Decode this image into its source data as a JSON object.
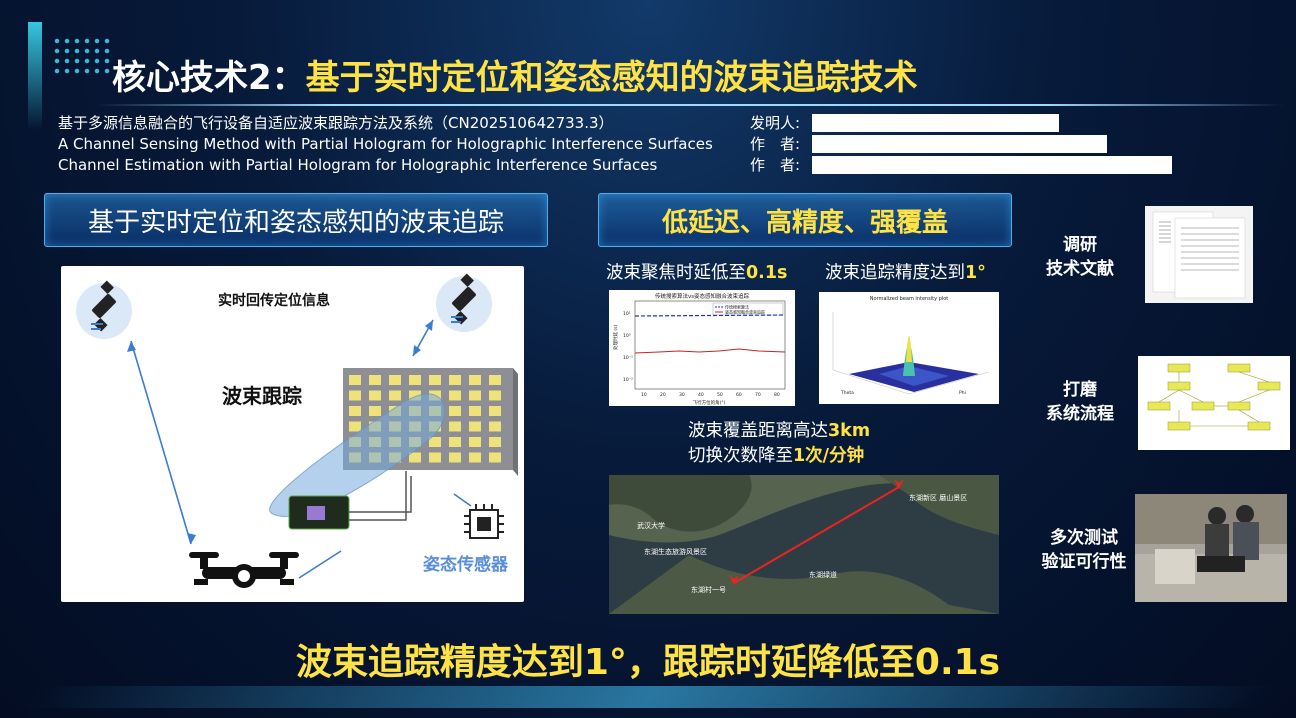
{
  "title": {
    "prefix": "核心技术2：",
    "main": "基于实时定位和姿态感知的波束追踪技术"
  },
  "info": {
    "lines": [
      "基于多源信息融合的飞行设备自适应波束跟踪方法及系统（CN202510642733.3）",
      "A Channel Sensing Method with Partial Hologram for Holographic Interference Surfaces",
      "Channel Estimation with Partial Hologram for Holographic Interference Surfaces"
    ],
    "labels": [
      "发明人:",
      "作　者:",
      "作　者:"
    ]
  },
  "left_panel": {
    "header": "基于实时定位和姿态感知的波束追踪",
    "realtime_label": "实时回传定位信息",
    "beam_label": "波束跟踪",
    "sensor_label": "姿态传感器"
  },
  "right_panel": {
    "header": "低延迟、高精度、强覆盖",
    "caption_delay": {
      "text": "波束聚焦时延低至",
      "value": "0.1s"
    },
    "caption_accuracy": {
      "text": "波束追踪精度达到",
      "value": "1°"
    },
    "caption_distance": {
      "text": "波束覆盖距离高达",
      "value": "3km"
    },
    "caption_switch": {
      "text": "切换次数降至",
      "value": "1次/分钟"
    },
    "chart1": {
      "title": "传统搜索算法vs姿态感知融合波束追踪",
      "legend": [
        "传统搜索算法",
        "姿态感知融合波束追踪"
      ],
      "ylabel": "处理时延 (s)",
      "xlabel": "飞行方位的角(°)",
      "xticks": [
        "10",
        "20",
        "30",
        "40",
        "50",
        "60",
        "70",
        "80"
      ],
      "yticks": [
        "10¹",
        "10⁰",
        "10⁻¹",
        "10⁻²"
      ]
    },
    "chart2": {
      "title": "Normalized beam intensity plot",
      "xlabel": "Theta",
      "ylabel": "Phi"
    },
    "map_labels": [
      "东湖生态旅游风景区",
      "东湖绿道",
      "武汉大学",
      "东湖村一号",
      "东湖新区 磨山景区"
    ]
  },
  "side": {
    "items": [
      {
        "label_line1": "调研",
        "label_line2": "技术文献"
      },
      {
        "label_line1": "打磨",
        "label_line2": "系统流程"
      },
      {
        "label_line1": "多次测试",
        "label_line2": "验证可行性"
      }
    ]
  },
  "bottom": {
    "text": "波束追踪精度达到1°，跟踪时延降低至0.1s"
  },
  "colors": {
    "accent": "#ffe243",
    "bg": "#071a3a",
    "panel_border": "#4bb0e8"
  }
}
